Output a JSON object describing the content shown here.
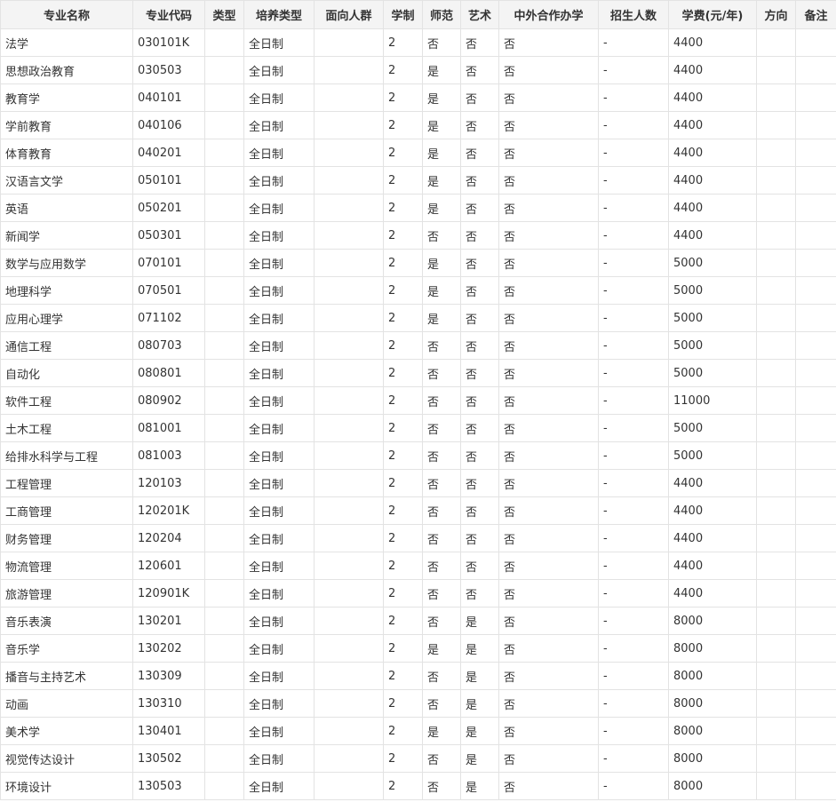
{
  "table": {
    "headers": [
      "专业名称",
      "专业代码",
      "类型",
      "培养类型",
      "面向人群",
      "学制",
      "师范",
      "艺术",
      "中外合作办学",
      "招生人数",
      "学费(元/年)",
      "方向",
      "备注"
    ],
    "rows": [
      [
        "法学",
        "030101K",
        "",
        "全日制",
        "",
        "2",
        "否",
        "否",
        "否",
        "-",
        "4400",
        "",
        ""
      ],
      [
        "思想政治教育",
        "030503",
        "",
        "全日制",
        "",
        "2",
        "是",
        "否",
        "否",
        "-",
        "4400",
        "",
        ""
      ],
      [
        "教育学",
        "040101",
        "",
        "全日制",
        "",
        "2",
        "是",
        "否",
        "否",
        "-",
        "4400",
        "",
        ""
      ],
      [
        "学前教育",
        "040106",
        "",
        "全日制",
        "",
        "2",
        "是",
        "否",
        "否",
        "-",
        "4400",
        "",
        ""
      ],
      [
        "体育教育",
        "040201",
        "",
        "全日制",
        "",
        "2",
        "是",
        "否",
        "否",
        "-",
        "4400",
        "",
        ""
      ],
      [
        "汉语言文学",
        "050101",
        "",
        "全日制",
        "",
        "2",
        "是",
        "否",
        "否",
        "-",
        "4400",
        "",
        ""
      ],
      [
        "英语",
        "050201",
        "",
        "全日制",
        "",
        "2",
        "是",
        "否",
        "否",
        "-",
        "4400",
        "",
        ""
      ],
      [
        "新闻学",
        "050301",
        "",
        "全日制",
        "",
        "2",
        "否",
        "否",
        "否",
        "-",
        "4400",
        "",
        ""
      ],
      [
        "数学与应用数学",
        "070101",
        "",
        "全日制",
        "",
        "2",
        "是",
        "否",
        "否",
        "-",
        "5000",
        "",
        ""
      ],
      [
        "地理科学",
        "070501",
        "",
        "全日制",
        "",
        "2",
        "是",
        "否",
        "否",
        "-",
        "5000",
        "",
        ""
      ],
      [
        "应用心理学",
        "071102",
        "",
        "全日制",
        "",
        "2",
        "是",
        "否",
        "否",
        "-",
        "5000",
        "",
        ""
      ],
      [
        "通信工程",
        "080703",
        "",
        "全日制",
        "",
        "2",
        "否",
        "否",
        "否",
        "-",
        "5000",
        "",
        ""
      ],
      [
        "自动化",
        "080801",
        "",
        "全日制",
        "",
        "2",
        "否",
        "否",
        "否",
        "-",
        "5000",
        "",
        ""
      ],
      [
        "软件工程",
        "080902",
        "",
        "全日制",
        "",
        "2",
        "否",
        "否",
        "否",
        "-",
        "11000",
        "",
        ""
      ],
      [
        "土木工程",
        "081001",
        "",
        "全日制",
        "",
        "2",
        "否",
        "否",
        "否",
        "-",
        "5000",
        "",
        ""
      ],
      [
        "给排水科学与工程",
        "081003",
        "",
        "全日制",
        "",
        "2",
        "否",
        "否",
        "否",
        "-",
        "5000",
        "",
        ""
      ],
      [
        "工程管理",
        "120103",
        "",
        "全日制",
        "",
        "2",
        "否",
        "否",
        "否",
        "-",
        "4400",
        "",
        ""
      ],
      [
        "工商管理",
        "120201K",
        "",
        "全日制",
        "",
        "2",
        "否",
        "否",
        "否",
        "-",
        "4400",
        "",
        ""
      ],
      [
        "财务管理",
        "120204",
        "",
        "全日制",
        "",
        "2",
        "否",
        "否",
        "否",
        "-",
        "4400",
        "",
        ""
      ],
      [
        "物流管理",
        "120601",
        "",
        "全日制",
        "",
        "2",
        "否",
        "否",
        "否",
        "-",
        "4400",
        "",
        ""
      ],
      [
        "旅游管理",
        "120901K",
        "",
        "全日制",
        "",
        "2",
        "否",
        "否",
        "否",
        "-",
        "4400",
        "",
        ""
      ],
      [
        "音乐表演",
        "130201",
        "",
        "全日制",
        "",
        "2",
        "否",
        "是",
        "否",
        "-",
        "8000",
        "",
        ""
      ],
      [
        "音乐学",
        "130202",
        "",
        "全日制",
        "",
        "2",
        "是",
        "是",
        "否",
        "-",
        "8000",
        "",
        ""
      ],
      [
        "播音与主持艺术",
        "130309",
        "",
        "全日制",
        "",
        "2",
        "否",
        "是",
        "否",
        "-",
        "8000",
        "",
        ""
      ],
      [
        "动画",
        "130310",
        "",
        "全日制",
        "",
        "2",
        "否",
        "是",
        "否",
        "-",
        "8000",
        "",
        ""
      ],
      [
        "美术学",
        "130401",
        "",
        "全日制",
        "",
        "2",
        "是",
        "是",
        "否",
        "-",
        "8000",
        "",
        ""
      ],
      [
        "视觉传达设计",
        "130502",
        "",
        "全日制",
        "",
        "2",
        "否",
        "是",
        "否",
        "-",
        "8000",
        "",
        ""
      ],
      [
        "环境设计",
        "130503",
        "",
        "全日制",
        "",
        "2",
        "否",
        "是",
        "否",
        "-",
        "8000",
        "",
        ""
      ]
    ]
  }
}
